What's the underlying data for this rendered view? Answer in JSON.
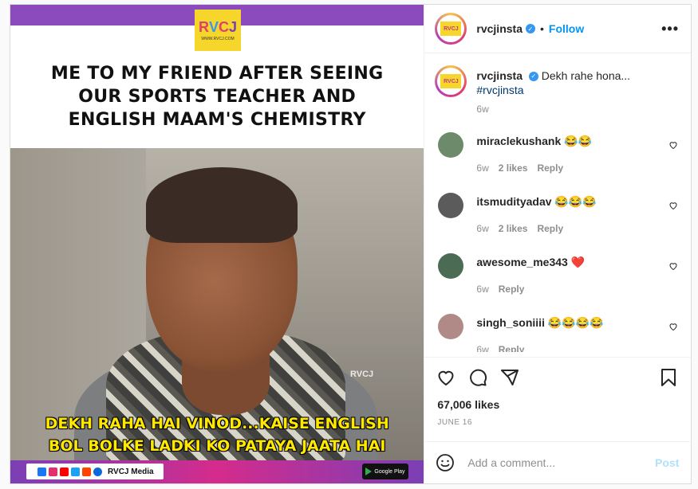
{
  "media": {
    "logo_text": "RVCJ",
    "logo_sub": "WWW.RVCJ.COM",
    "caption": "ME TO MY FRIEND AFTER SEEING OUR SPORTS TEACHER AND ENGLISH MAAM'S CHEMISTRY",
    "watermark": "RVCJ",
    "subtitle_line1": "DEKH RAHA HAI VINOD...KAISE ENGLISH",
    "subtitle_line2": "BOL BOLKE LADKI KO PATAYA JAATA HAI",
    "footer_brand": "RVCJ Media",
    "store_label": "Google Play"
  },
  "header": {
    "username": "rvcjinsta",
    "follow_label": "Follow",
    "more_label": "•••",
    "avatar_text": "RVCJ"
  },
  "caption": {
    "username": "rvcjinsta",
    "text": "Dekh rahe hona...",
    "hashtag": "#rvcjinsta",
    "time": "6w"
  },
  "comments": [
    {
      "username": "miraclekushank",
      "text": "😂😂",
      "time": "6w",
      "likes": "2 likes",
      "reply": "Reply",
      "avatar_color": "#6d8a6a"
    },
    {
      "username": "itsmudityadav",
      "text": "😂😂😂",
      "time": "6w",
      "likes": "2 likes",
      "reply": "Reply",
      "avatar_color": "#5b5b5b"
    },
    {
      "username": "awesome_me343",
      "text": "❤️",
      "time": "6w",
      "likes": "",
      "reply": "Reply",
      "avatar_color": "#4c6b55"
    },
    {
      "username": "singh_soniiii",
      "text": "😂😂😂😂",
      "time": "6w",
      "likes": "",
      "reply": "Reply",
      "avatar_color": "#b08a86"
    }
  ],
  "post": {
    "likes": "67,006 likes",
    "date": "JUNE 16"
  },
  "add_comment": {
    "placeholder": "Add a comment...",
    "post_label": "Post"
  },
  "colors": {
    "accent": "#0095f6",
    "post_disabled": "#b2dffc",
    "verified": "#3797f0",
    "subtitle_yellow": "#ffe800"
  }
}
